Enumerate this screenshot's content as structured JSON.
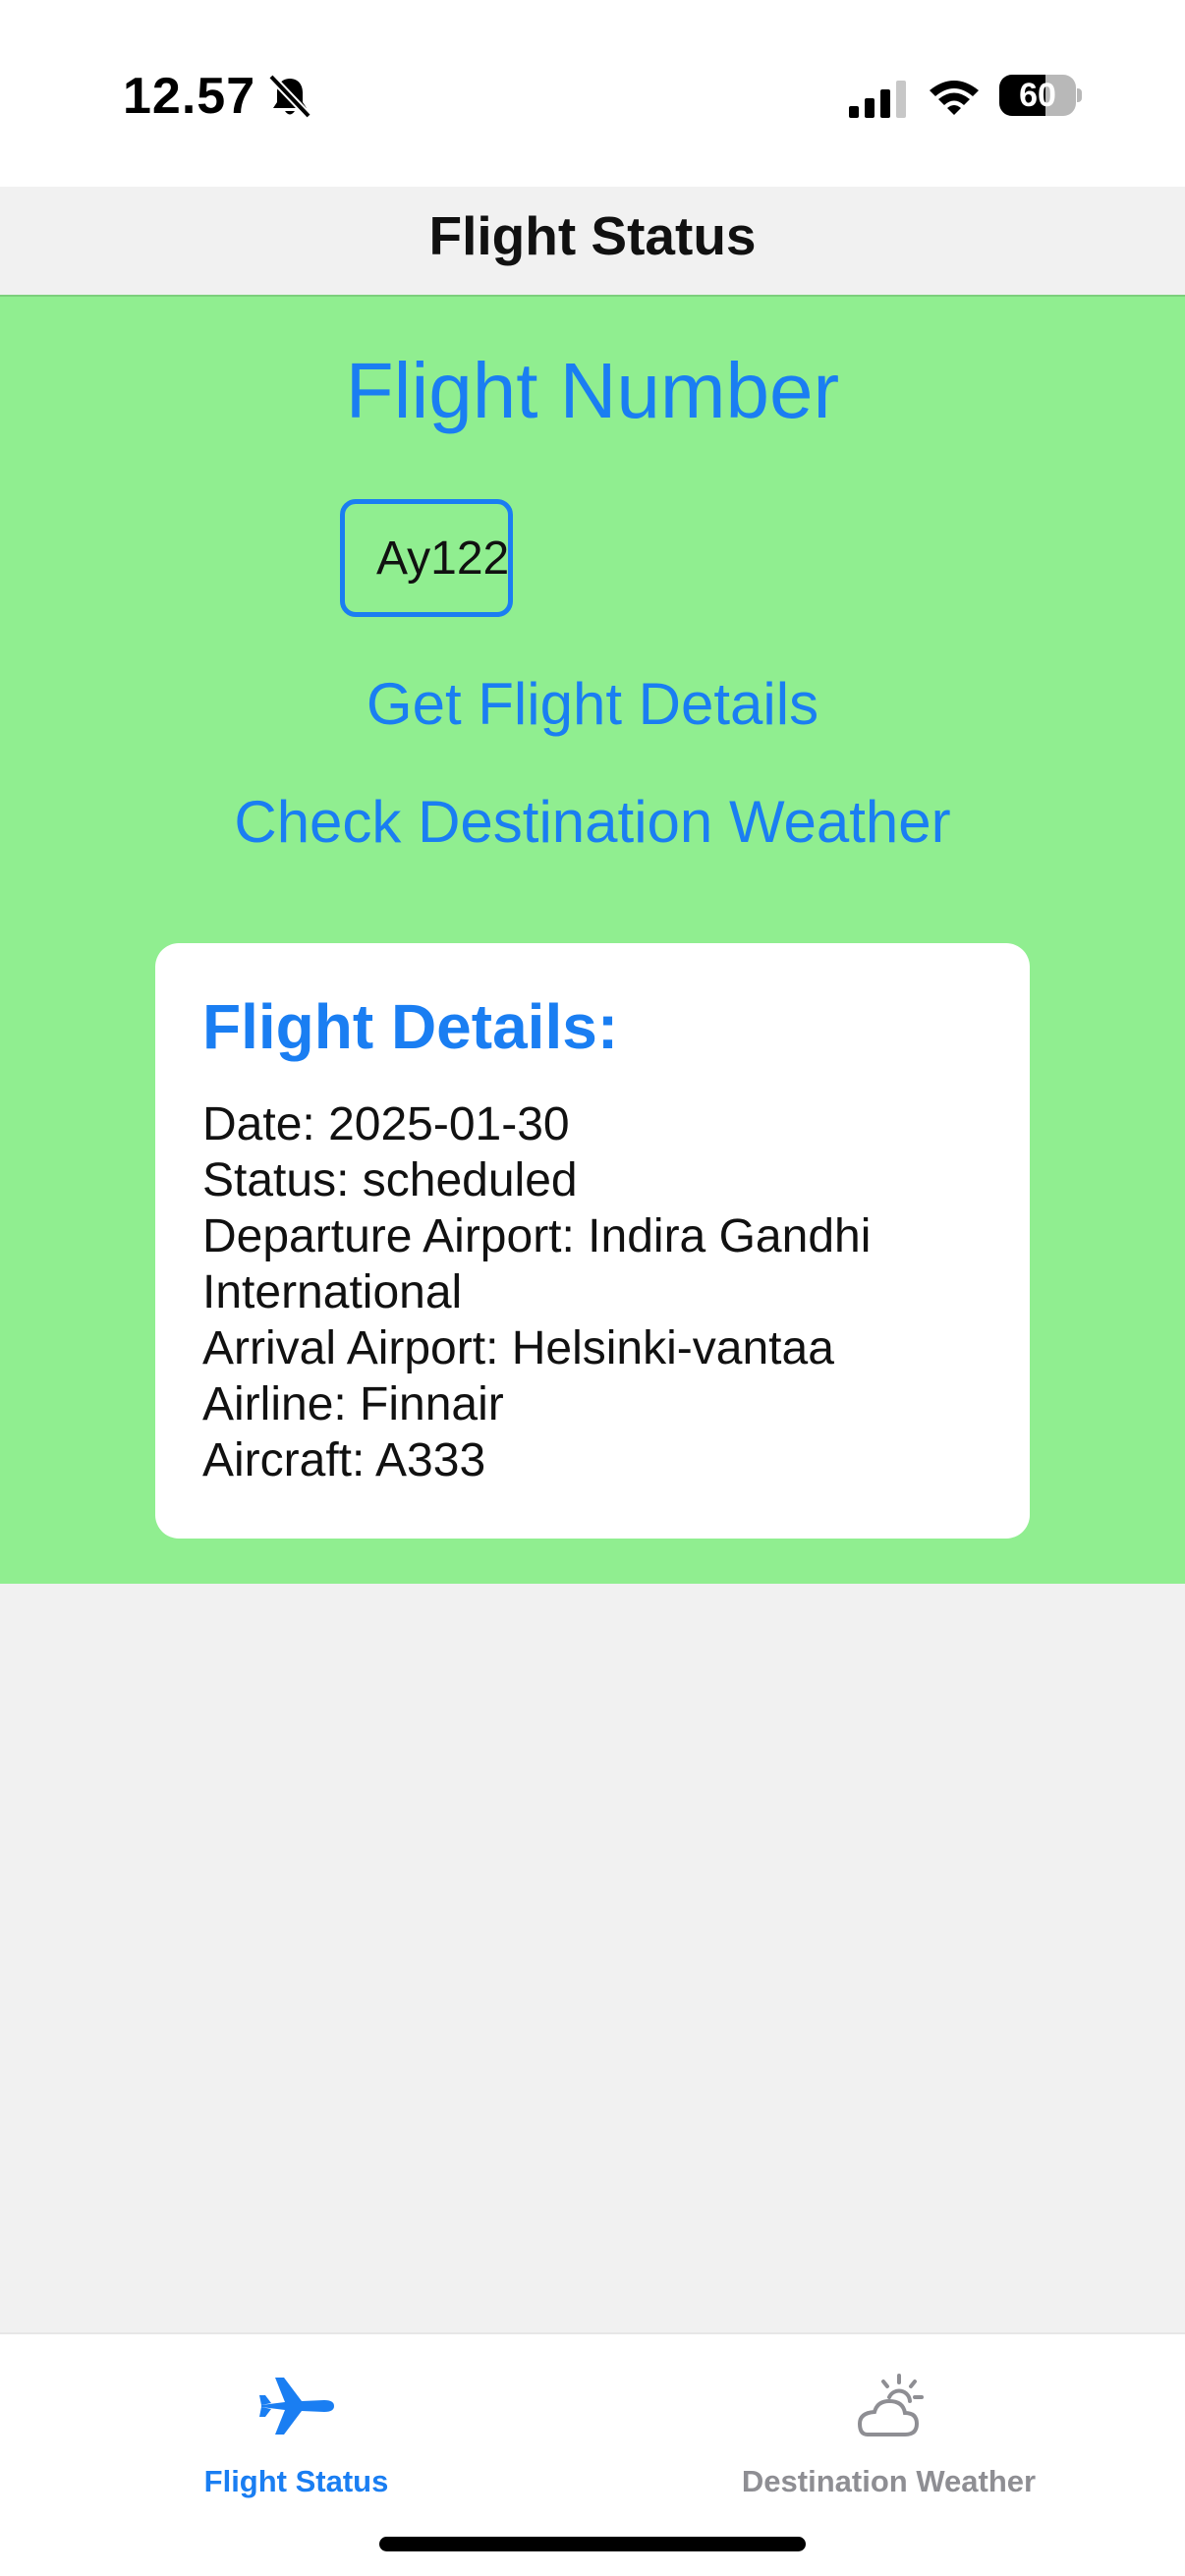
{
  "status_bar": {
    "time": "12.57",
    "battery_level": "60",
    "battery_fraction": 0.6
  },
  "nav": {
    "title": "Flight Status"
  },
  "form": {
    "section_title": "Flight Number",
    "flight_number_value": "Ay122",
    "get_details_label": "Get Flight Details",
    "check_weather_label": "Check Destination Weather"
  },
  "details": {
    "title": "Flight Details:",
    "date": "Date: 2025-01-30",
    "status": "Status: scheduled",
    "departure": "Departure Airport: Indira Gandhi",
    "departure_cont": "International",
    "arrival": "Arrival Airport: Helsinki-vantaa",
    "airline": "Airline: Finnair",
    "aircraft": "Aircraft: A333"
  },
  "tabbar": {
    "tabs": [
      {
        "label": "Flight Status",
        "icon": "airplane-icon",
        "active": true
      },
      {
        "label": "Destination Weather",
        "icon": "cloud-sun-icon",
        "active": false
      }
    ]
  },
  "colors": {
    "accent": "#1a7ef2",
    "content_background": "#90ee90",
    "inactive_tab": "#8e8e93"
  }
}
